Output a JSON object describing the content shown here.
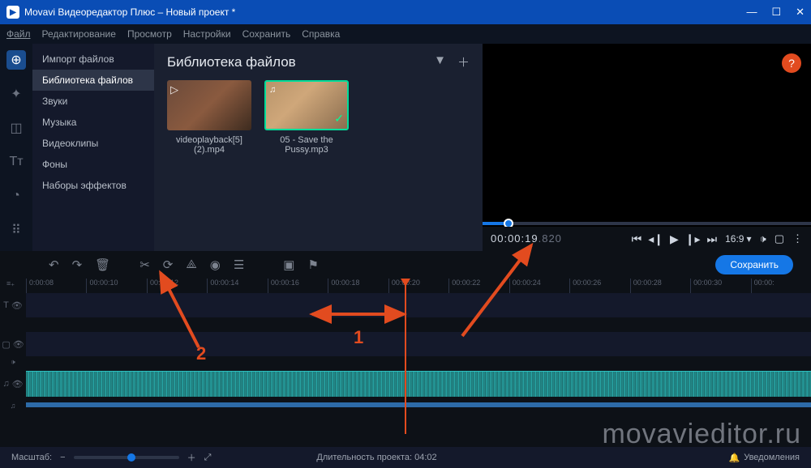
{
  "titlebar": {
    "title": "Movavi Видеоредактор Плюс – Новый проект *"
  },
  "menu": {
    "items": [
      "Файл",
      "Редактирование",
      "Просмотр",
      "Настройки",
      "Сохранить",
      "Справка"
    ]
  },
  "categories": {
    "items": [
      {
        "label": "Импорт файлов"
      },
      {
        "label": "Библиотека файлов",
        "active": true
      },
      {
        "label": "Звуки"
      },
      {
        "label": "Музыка"
      },
      {
        "label": "Видеоклипы"
      },
      {
        "label": "Фоны"
      },
      {
        "label": "Наборы эффектов"
      }
    ]
  },
  "library": {
    "title": "Библиотека файлов",
    "items": [
      {
        "name": "videoplayback[5](2).mp4",
        "type": "video"
      },
      {
        "name": "05 - Save the Pussy.mp3",
        "type": "audio"
      }
    ]
  },
  "preview": {
    "timecode": "00:00:19",
    "timecode_ms": ".820",
    "aspect": "16:9"
  },
  "toolbar": {
    "save": "Сохранить"
  },
  "ruler": {
    "ticks": [
      "0:00:08",
      "00:00:10",
      "00:00:12",
      "00:00:14",
      "00:00:16",
      "00:00:18",
      "00:00:20",
      "00:00:22",
      "00:00:24",
      "00:00:26",
      "00:00:28",
      "00:00:30",
      "00:00:"
    ]
  },
  "footer": {
    "zoom_label": "Масштаб:",
    "duration_label": "Длительность проекта: 04:02",
    "notif": "Уведомления"
  },
  "annotations": {
    "a1": "1",
    "a2": "2"
  },
  "watermark": "movavieditor.ru"
}
